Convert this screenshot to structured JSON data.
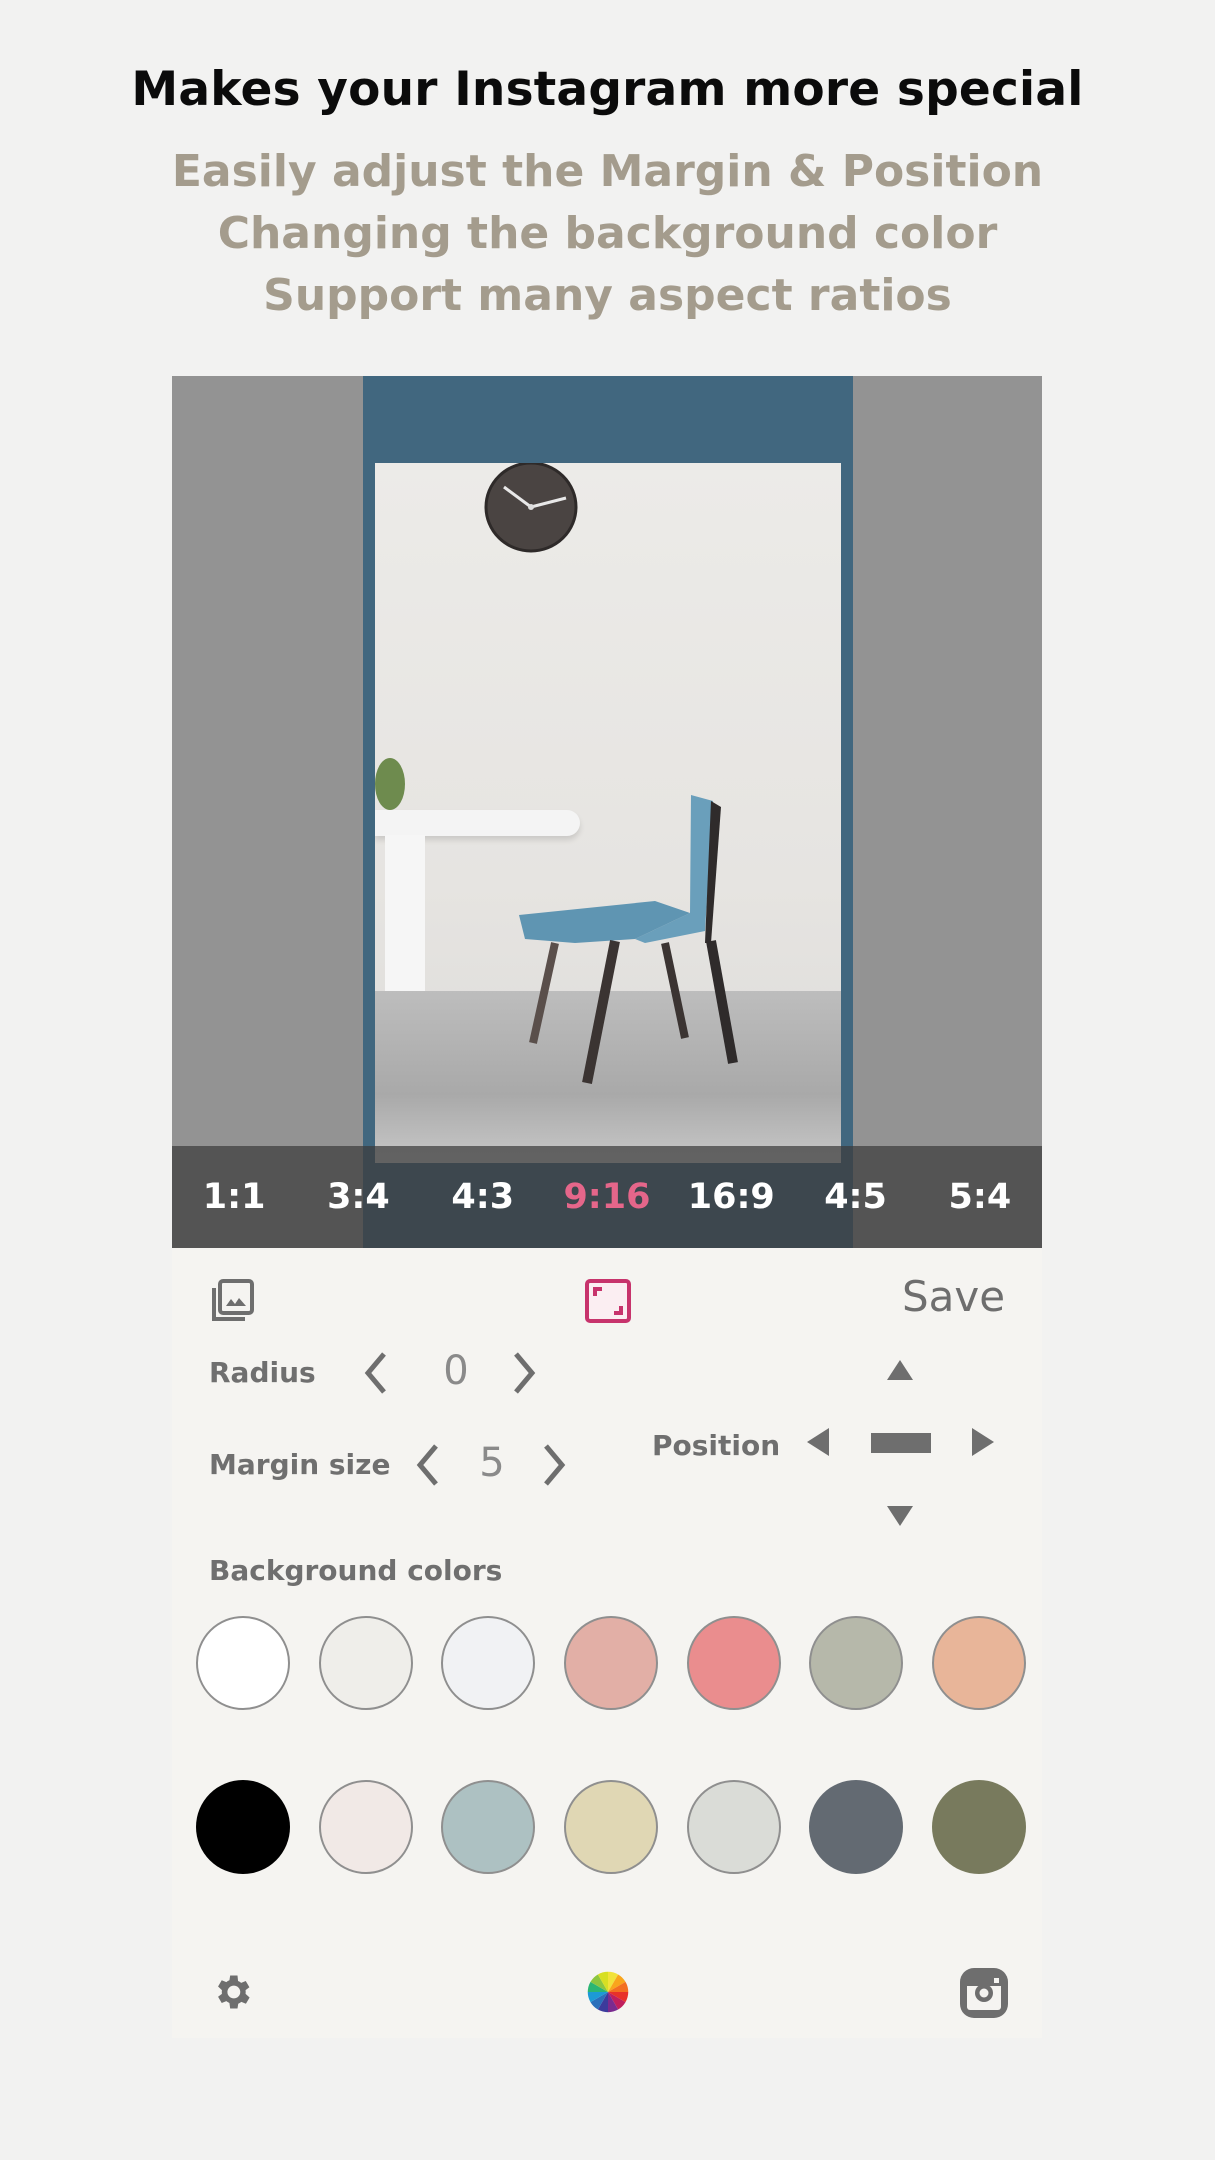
{
  "header": {
    "title": "Makes your Instagram more special",
    "features": [
      "Easily adjust the Margin & Position",
      "Changing the background color",
      "Support many aspect ratios"
    ]
  },
  "ratios": {
    "items": [
      "1:1",
      "3:4",
      "4:3",
      "9:16",
      "16:9",
      "4:5",
      "5:4"
    ],
    "selected": "9:16",
    "active_color": "#e5668a"
  },
  "toolbar": {
    "gallery_icon": "gallery-icon",
    "fit_icon": "fit-frame-icon",
    "save_label": "Save",
    "accent_color": "#c7336c"
  },
  "controls": {
    "radius_label": "Radius",
    "radius_value": "0",
    "margin_label": "Margin size",
    "margin_value": "5",
    "position_label": "Position"
  },
  "background": {
    "label": "Background colors",
    "frame_color": "#41677f",
    "swatches_row1": [
      "#ffffff",
      "#efeeea",
      "#f1f2f4",
      "#e2afa6",
      "#ea8d8e",
      "#b6b8aa",
      "#e8b599"
    ],
    "swatches_row2": [
      "#000000",
      "#f1e9e6",
      "#adc1c2",
      "#e0d7b4",
      "#dadcd7",
      "#636a72",
      "#787a5d"
    ]
  },
  "bottom_bar": {
    "settings_icon": "gear-icon",
    "color_wheel_icon": "color-wheel-icon",
    "instagram_icon": "instagram-icon"
  }
}
